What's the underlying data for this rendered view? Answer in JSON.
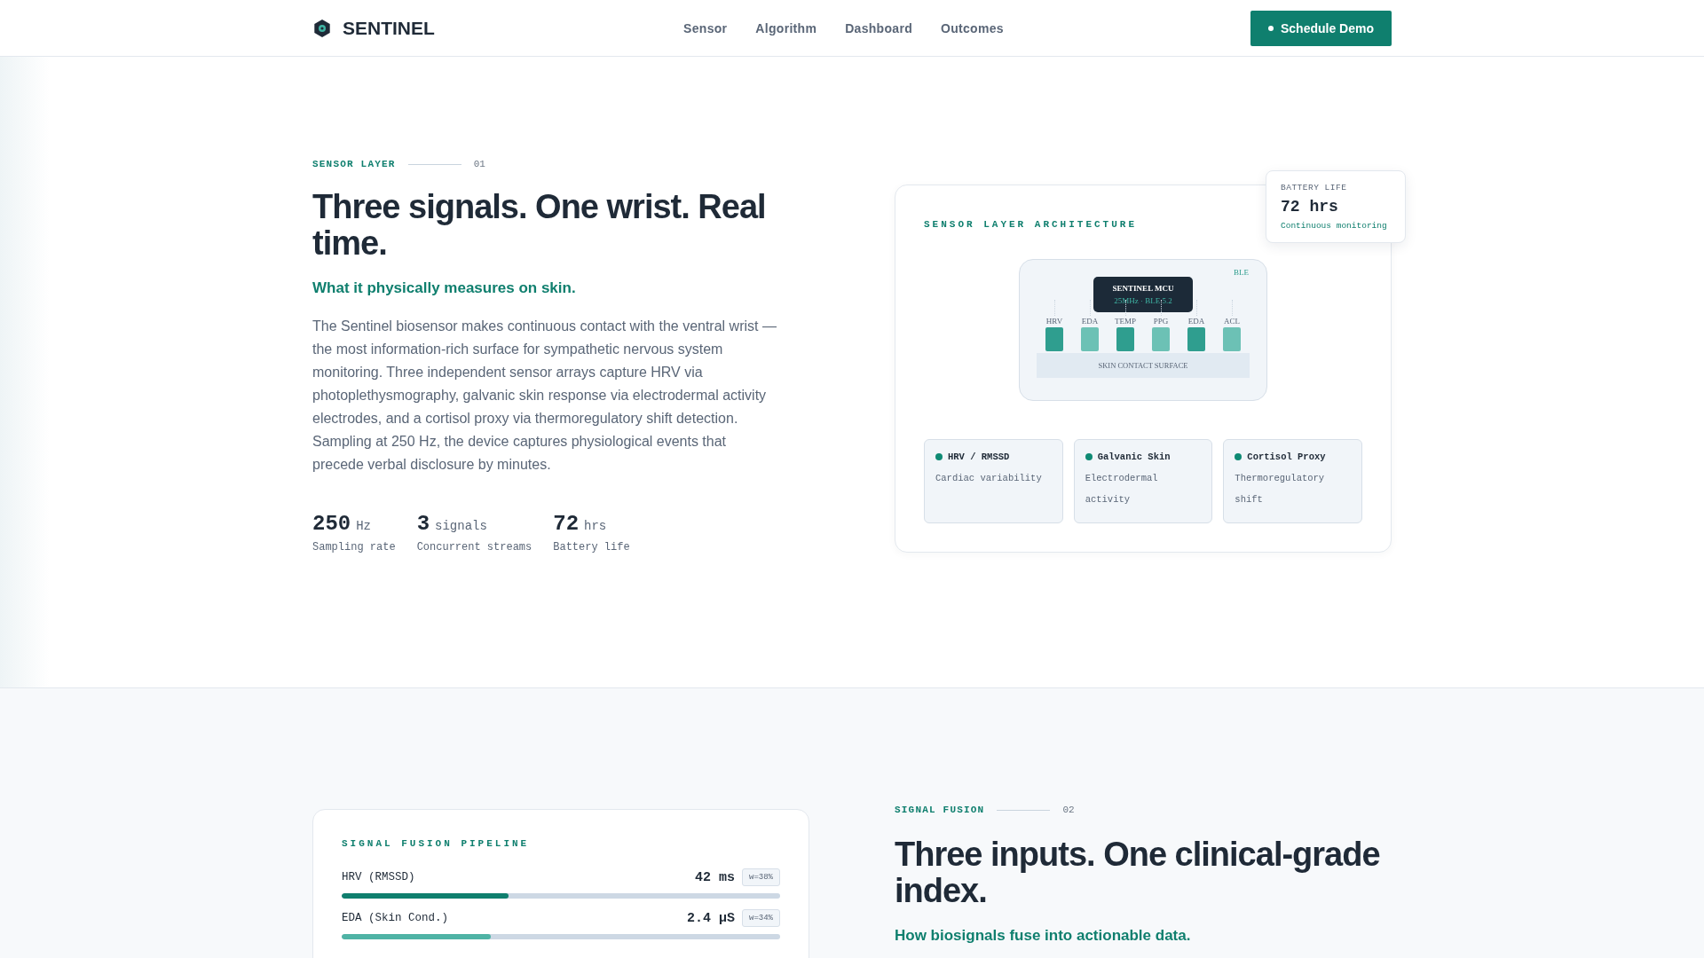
{
  "header": {
    "brand": "SENTINEL",
    "nav": [
      {
        "label": "Sensor"
      },
      {
        "label": "Algorithm"
      },
      {
        "label": "Dashboard"
      },
      {
        "label": "Outcomes"
      }
    ],
    "cta": "Schedule Demo"
  },
  "sensor_section": {
    "eyebrow": "SENSOR LAYER",
    "number": "01",
    "heading": "Three signals. One wrist. Real time.",
    "subheading": "What it physically measures on skin.",
    "body": "The Sentinel biosensor makes continuous contact with the ventral wrist — the most information-rich surface for sympathetic nervous system monitoring. Three independent sensor arrays capture HRV via photoplethysmography, galvanic skin response via electrodermal activity electrodes, and a cortisol proxy via thermoregulatory shift detection. Sampling at 250 Hz, the device captures physiological events that precede verbal disclosure by minutes.",
    "stats": [
      {
        "value": "250",
        "unit": "Hz",
        "label": "Sampling rate"
      },
      {
        "value": "3",
        "unit": "signals",
        "label": "Concurrent streams"
      },
      {
        "value": "72",
        "unit": "hrs",
        "label": "Battery life"
      }
    ],
    "card": {
      "title": "SENSOR LAYER ARCHITECTURE",
      "battery": {
        "label": "BATTERY LIFE",
        "value": "72 hrs",
        "note": "Continuous monitoring"
      },
      "diagram": {
        "badge": "BLE",
        "mcu": "SENTINEL MCU",
        "mcu_spec": "25MHz · BLE 5.2",
        "surface": "SKIN CONTACT SURFACE",
        "sensors": [
          {
            "label": "HRV",
            "color": "#2f9e8f"
          },
          {
            "label": "EDA",
            "color": "#6cc1b5"
          },
          {
            "label": "TEMP",
            "color": "#2f9e8f"
          },
          {
            "label": "PPG",
            "color": "#6cc1b5"
          },
          {
            "label": "EDA",
            "color": "#2f9e8f"
          },
          {
            "label": "ACL",
            "color": "#6cc1b5"
          }
        ]
      },
      "signals": [
        {
          "name": "HRV / RMSSD",
          "description": "Cardiac variability"
        },
        {
          "name": "Galvanic Skin",
          "description": "Electrodermal activity"
        },
        {
          "name": "Cortisol Proxy",
          "description": "Thermoregulatory shift"
        }
      ]
    }
  },
  "fusion_section": {
    "eyebrow": "SIGNAL FUSION",
    "number": "02",
    "heading": "Three inputs. One clinical-grade index.",
    "subheading": "How biosignals fuse into actionable data.",
    "pipeline": {
      "title": "SIGNAL FUSION PIPELINE",
      "rows": [
        {
          "name": "HRV (RMSSD)",
          "reading": "42 ms",
          "weight": "w=38%",
          "level": 0.38,
          "color": "#0f7f6e"
        },
        {
          "name": "EDA (Skin Cond.)",
          "reading": "2.4 µS",
          "weight": "w=34%",
          "level": 0.34,
          "color": "#4fb3a5"
        }
      ]
    }
  }
}
